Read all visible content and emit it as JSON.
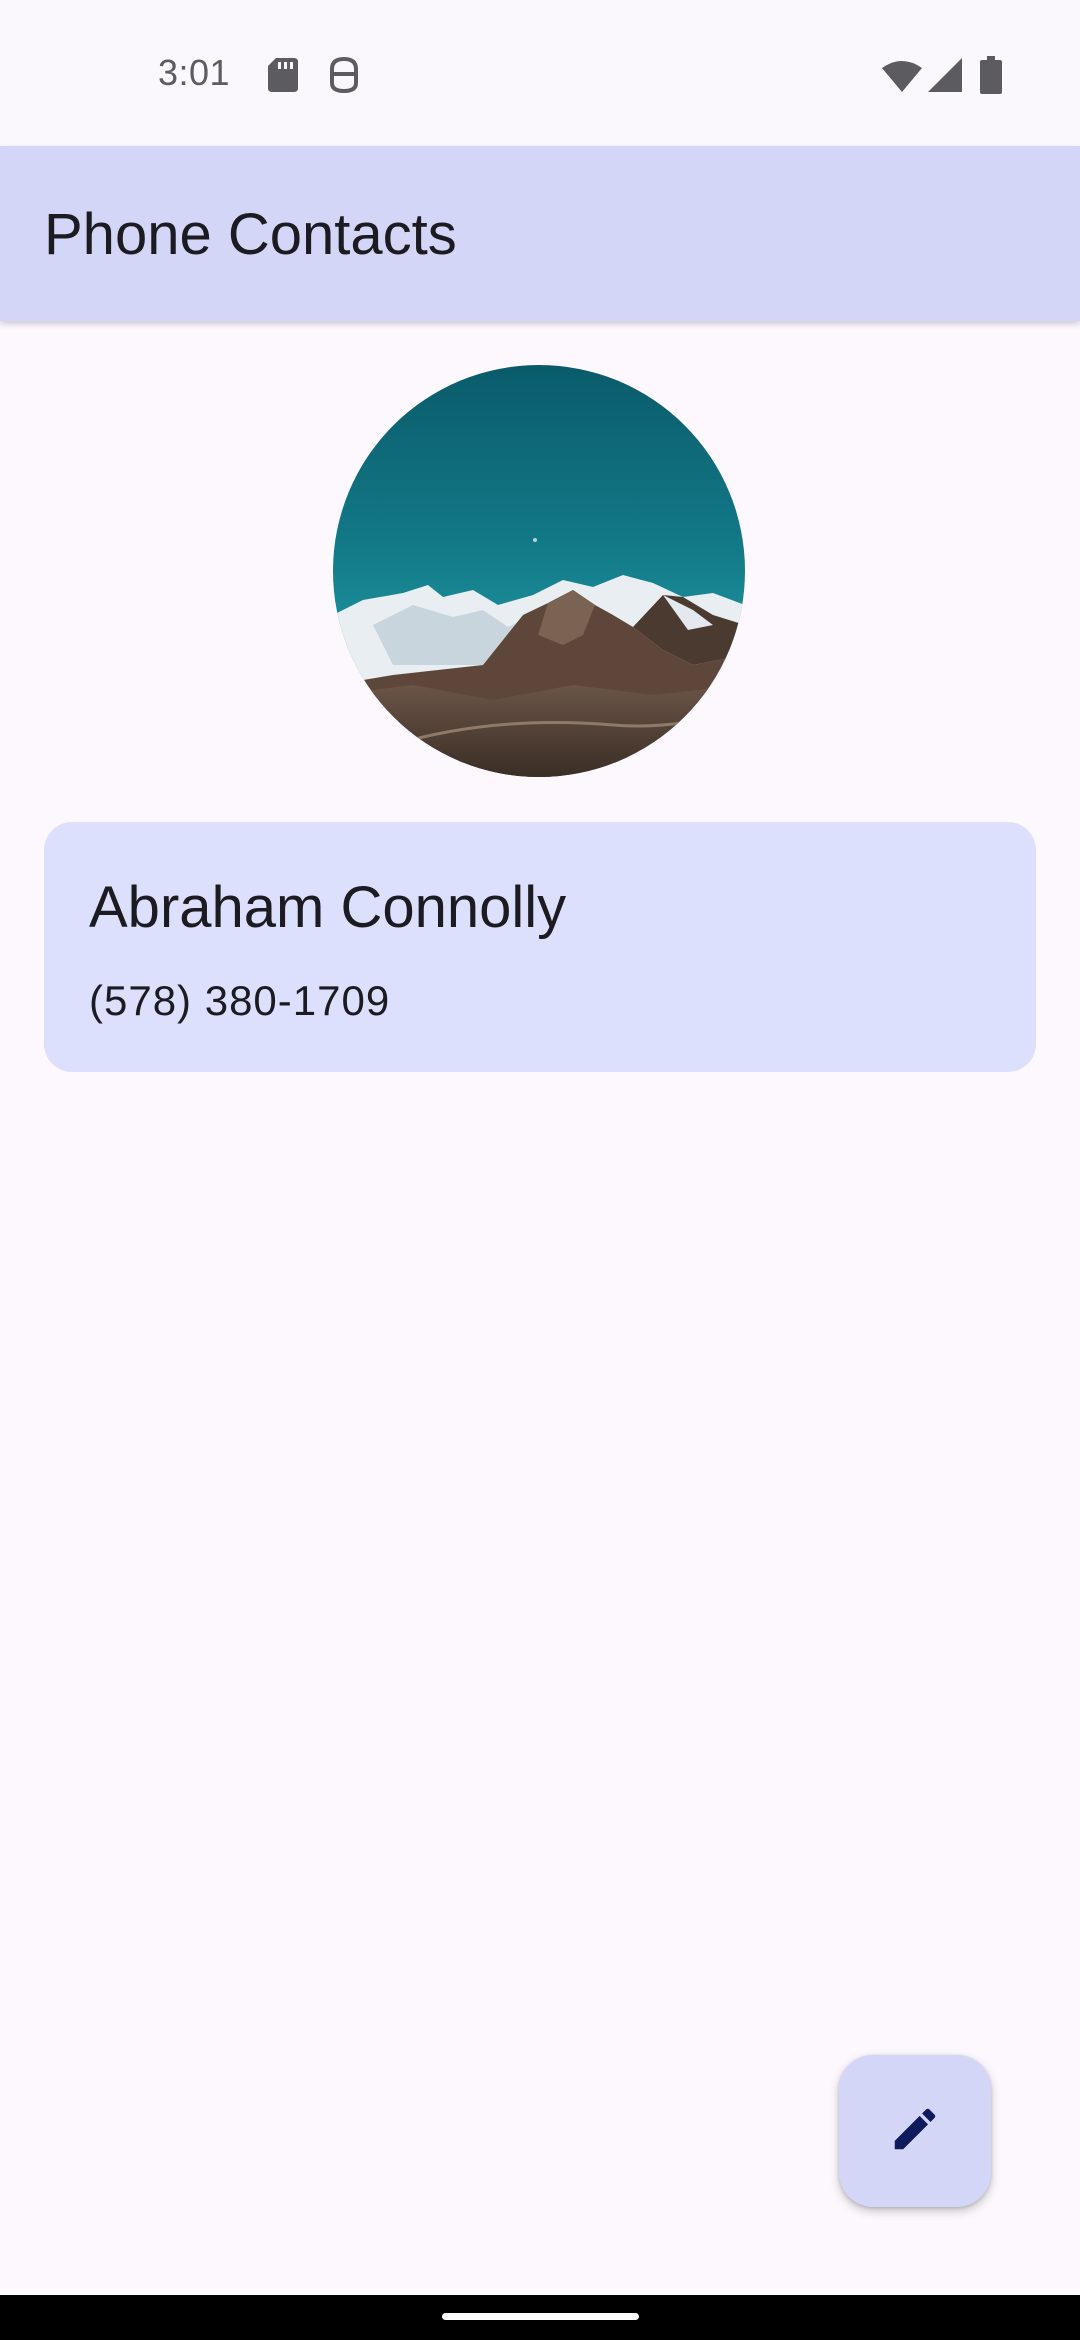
{
  "status_bar": {
    "time": "3:01",
    "left_icons": [
      "sd-card-icon",
      "debug-icon"
    ],
    "right_icons": [
      "wifi-icon",
      "cell-signal-icon",
      "battery-icon"
    ]
  },
  "app_bar": {
    "title": "Phone Contacts"
  },
  "contact": {
    "avatar": "mountain-landscape-photo",
    "name": "Abraham Connolly",
    "phone": "(578) 380-1709"
  },
  "fab": {
    "icon": "edit-pencil-icon"
  },
  "colors": {
    "background": "#fcf8fd",
    "app_bar": "#d3d6f6",
    "card": "#dde0fd",
    "fab": "#d3d6f6",
    "fab_icon": "#0f1c5c",
    "text": "#1b1b21"
  }
}
